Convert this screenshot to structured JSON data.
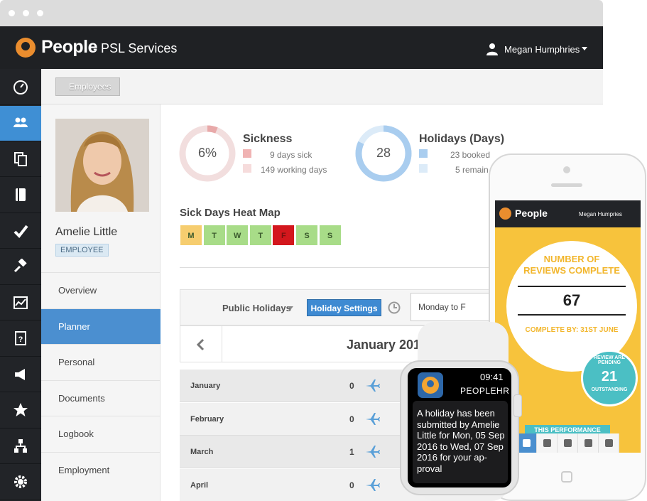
{
  "app": {
    "brand": "People",
    "company": "- PSL Services",
    "user": "Megan Humphries"
  },
  "breadcrumb": {
    "label": "Employees"
  },
  "nav_icons": [
    "dashboard-icon",
    "people-icon",
    "documents-icon",
    "notebook-icon",
    "check-icon",
    "gavel-icon",
    "chart-icon",
    "help-document-icon",
    "megaphone-icon",
    "star-icon",
    "org-chart-icon",
    "settings-icon"
  ],
  "profile": {
    "name": "Amelie Little",
    "badge": "EMPLOYEE"
  },
  "menu": [
    "Overview",
    "Planner",
    "Personal",
    "Documents",
    "Logbook",
    "Employment"
  ],
  "sickness": {
    "percent_label": "6%",
    "title": "Sickness",
    "days": "9 days sick",
    "working": "149 working days",
    "percent": 0.06,
    "ring_color": "#f1dada",
    "accent": "#e8a9a9"
  },
  "holidays": {
    "value_label": "28",
    "title": "Holidays (Days)",
    "booked": "23 booked",
    "remaining": "5 remain",
    "booked_fraction": 0.82,
    "ring_color": "#a9cdef",
    "light": "#dcebf8"
  },
  "heatmap": {
    "title": "Sick Days Heat Map",
    "days": [
      "M",
      "T",
      "W",
      "T",
      "F",
      "S",
      "S"
    ],
    "colors": [
      "#f6cd6f",
      "#a8dc88",
      "#a8dc88",
      "#a8dc88",
      "#d3171d",
      "#a8dc88",
      "#a8dc88"
    ]
  },
  "planner": {
    "public_holidays": "Public Holidays",
    "holiday_settings": "Holiday Settings",
    "date_value": "Monday to F",
    "month_title": "January 2016",
    "months": [
      {
        "name": "January",
        "count": "0"
      },
      {
        "name": "February",
        "count": "0"
      },
      {
        "name": "March",
        "count": "1"
      },
      {
        "name": "April",
        "count": "0"
      }
    ]
  },
  "watch": {
    "time": "09:41",
    "app": "PEOPLEHR",
    "message": "A holiday has been submitted by Amelie Little for Mon, 05 Sep 2016 to Wed, 07 Sep 2016 for your ap-proval"
  },
  "phone": {
    "brand": "People",
    "user": "Megan Humpries",
    "reviews_title": "NUMBER OF REVIEWS COMPLETE",
    "reviews_value": "67",
    "complete_by": "COMPLETE BY: 31ST JUNE",
    "pending_top": "REVIEW ARE PENDING",
    "pending_value": "21",
    "pending_bottom": "OUTSTANDING",
    "performance": "THIS PERFORMANCE"
  }
}
